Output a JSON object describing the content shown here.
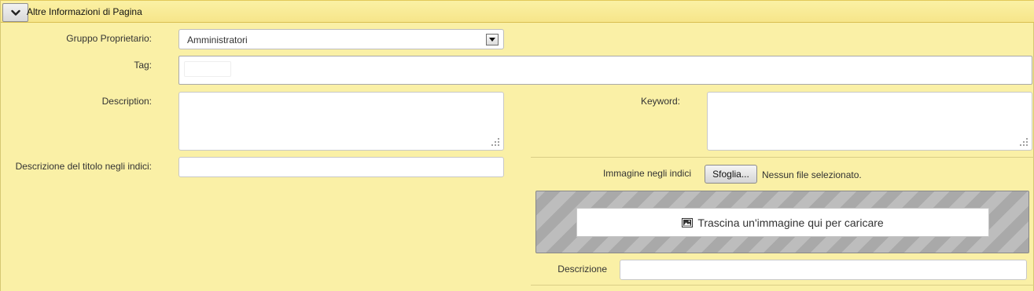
{
  "header": {
    "title": "Altre Informazioni di Pagina",
    "toggle_icon": "chevron-down-icon"
  },
  "fields": {
    "owner_group": {
      "label": "Gruppo Proprietario:",
      "value": "Amministratori"
    },
    "tag": {
      "label": "Tag:"
    },
    "description": {
      "label": "Description:"
    },
    "keyword": {
      "label": "Keyword:"
    },
    "index_title_desc": {
      "label": "Descrizione del titolo negli indici:"
    }
  },
  "image_upload": {
    "label": "Immagine negli indici",
    "browse_label": "Sfoglia...",
    "no_file_text": "Nessun file selezionato.",
    "dropzone_text": "Trascina un'immagine qui per caricare",
    "dropzone_icon": "image-icon",
    "caption_label": "Descrizione"
  },
  "colors": {
    "panel_bg": "#faf0a6",
    "dropzone_stripe_dark": "#a9a9a9",
    "dropzone_stripe_light": "#bdbdbd"
  }
}
